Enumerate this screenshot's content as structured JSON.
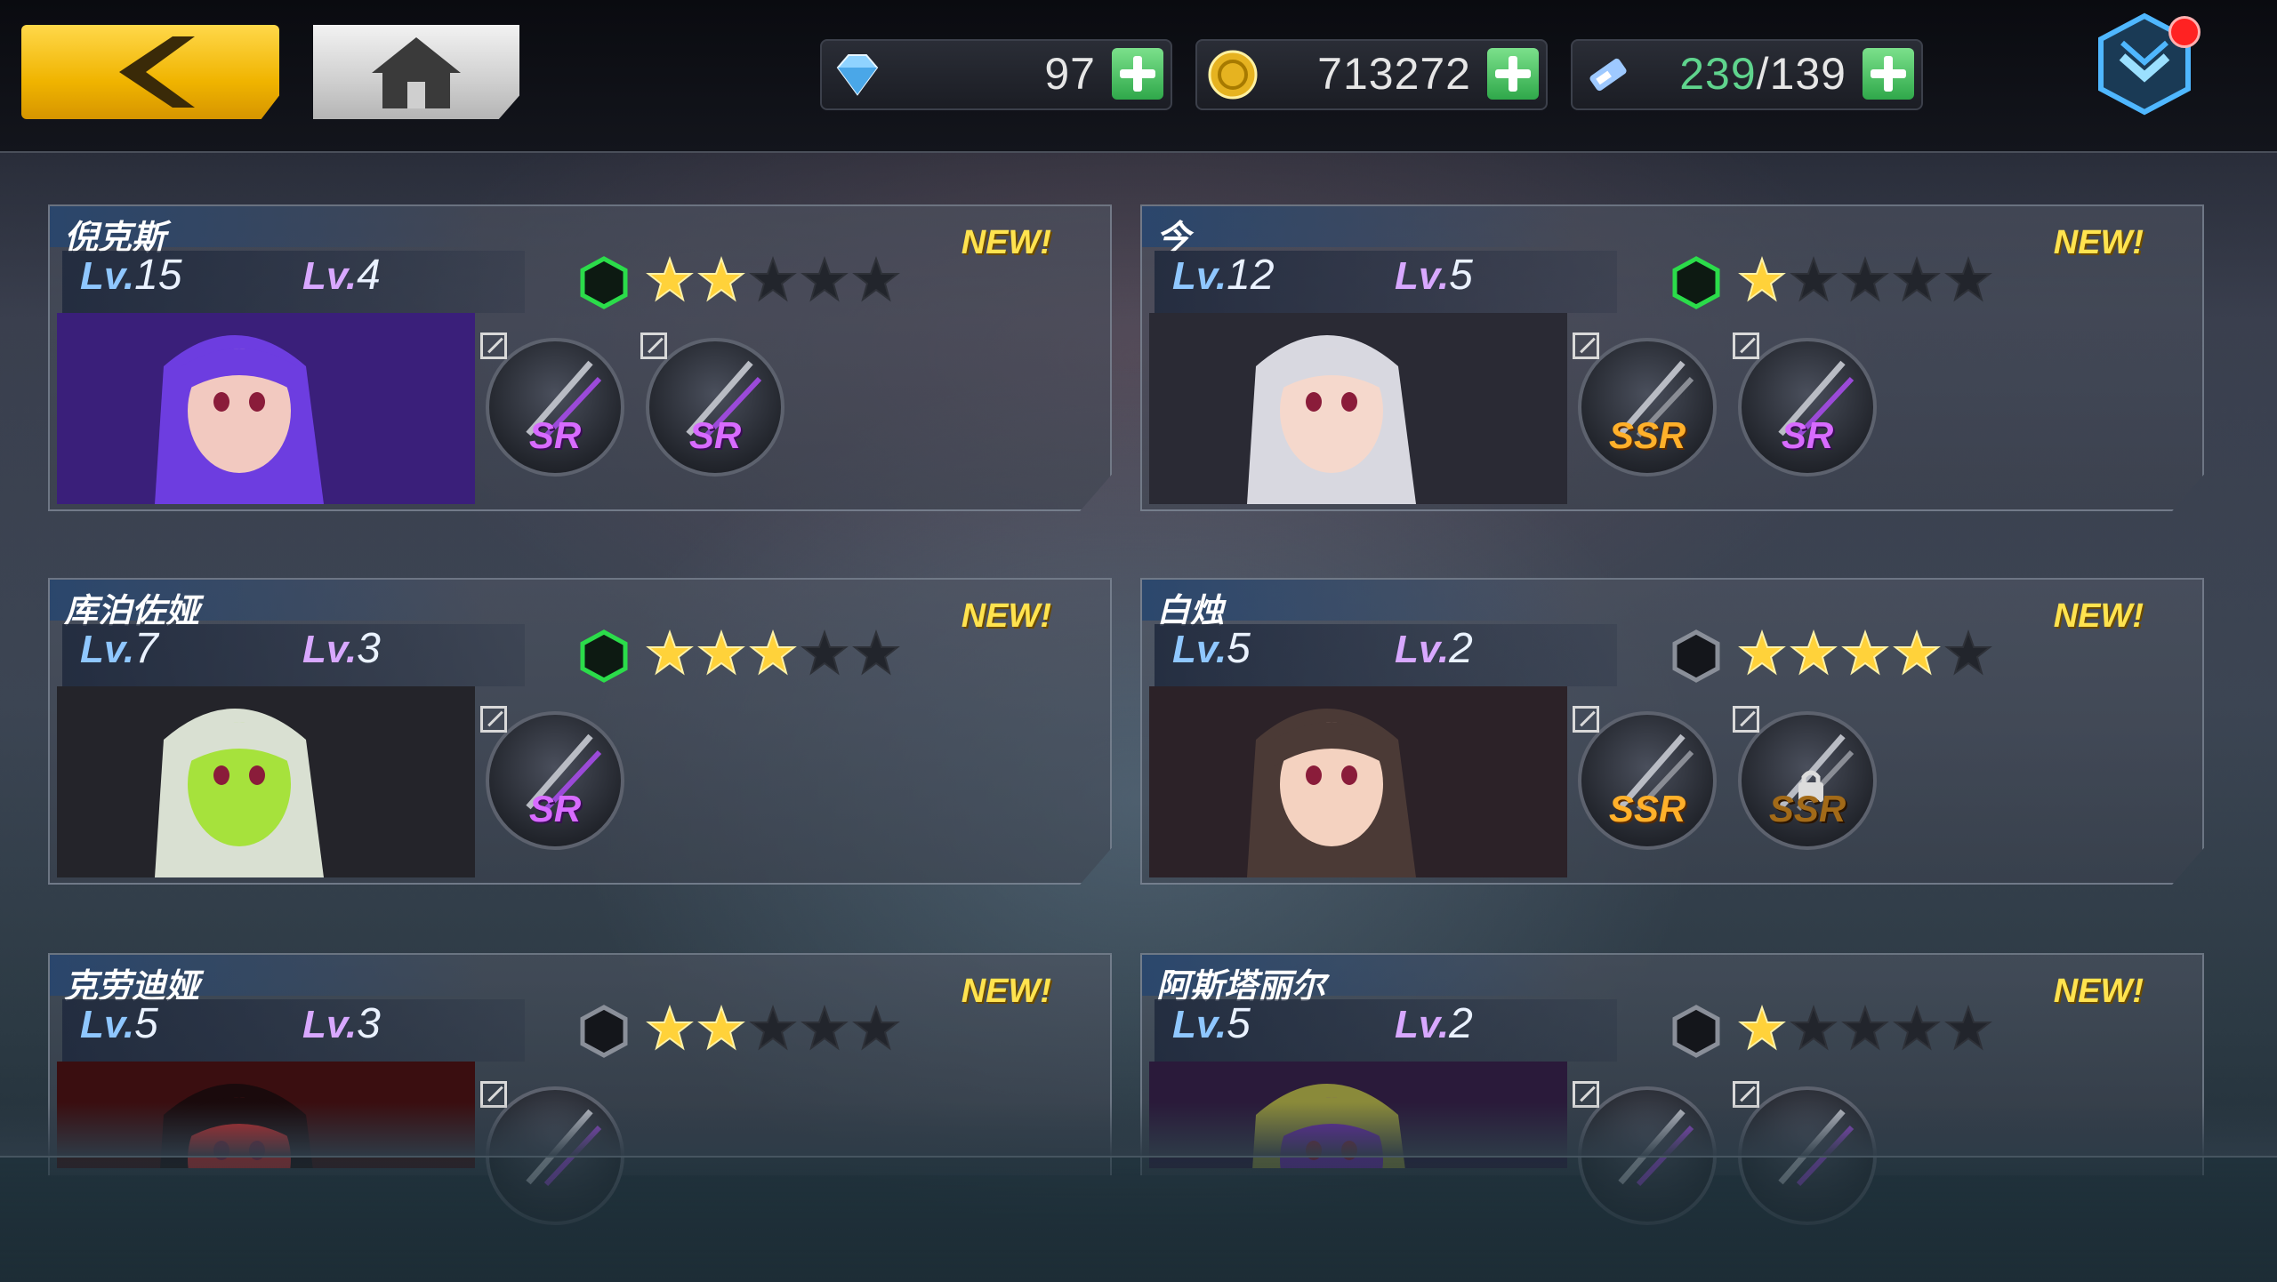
{
  "resources": {
    "diamonds": {
      "value": "97",
      "icon": "diamond-icon"
    },
    "gold": {
      "value": "713272",
      "icon": "coin-icon"
    },
    "stamina": {
      "current": "239",
      "max": "/139",
      "icon": "energy-ticket-icon"
    }
  },
  "colors": {
    "accent_yellow": "#f0b400",
    "plus_green": "#2fa84a",
    "sr": "#d86bff",
    "ssr": "#ffb02a",
    "new": "#ffe34f"
  },
  "cards": [
    {
      "name": "倪克斯",
      "new": "NEW!",
      "lv_prefix": "Lv.",
      "lv": "15",
      "rank_prefix": "Lv.",
      "rank": "4",
      "hex": "green",
      "stars": 2,
      "equips": [
        {
          "rarity": "SR",
          "locked": false
        },
        {
          "rarity": "SR",
          "locked": false
        }
      ],
      "portrait": "purple"
    },
    {
      "name": "今",
      "new": "NEW!",
      "lv_prefix": "Lv.",
      "lv": "12",
      "rank_prefix": "Lv.",
      "rank": "5",
      "hex": "green",
      "stars": 1,
      "equips": [
        {
          "rarity": "SSR",
          "locked": false
        },
        {
          "rarity": "SR",
          "locked": false
        }
      ],
      "portrait": "white"
    },
    {
      "name": "库泊佐娅",
      "new": "NEW!",
      "lv_prefix": "Lv.",
      "lv": "7",
      "rank_prefix": "Lv.",
      "rank": "3",
      "hex": "green",
      "stars": 3,
      "equips": [
        {
          "rarity": "SR",
          "locked": false
        }
      ],
      "portrait": "green"
    },
    {
      "name": "白烛",
      "new": "NEW!",
      "lv_prefix": "Lv.",
      "lv": "5",
      "rank_prefix": "Lv.",
      "rank": "2",
      "hex": "grey",
      "stars": 4,
      "equips": [
        {
          "rarity": "SSR",
          "locked": false
        },
        {
          "rarity": "SSR",
          "locked": true
        }
      ],
      "portrait": "brown"
    },
    {
      "name": "克劳迪娅",
      "new": "NEW!",
      "lv_prefix": "Lv.",
      "lv": "5",
      "rank_prefix": "Lv.",
      "rank": "3",
      "hex": "grey",
      "stars": 2,
      "equips": [
        {
          "rarity": "",
          "locked": false
        }
      ],
      "portrait": "red"
    },
    {
      "name": "阿斯塔丽尔",
      "new": "NEW!",
      "lv_prefix": "Lv.",
      "lv": "5",
      "rank_prefix": "Lv.",
      "rank": "2",
      "hex": "grey",
      "stars": 1,
      "equips": [
        {
          "rarity": "",
          "locked": false
        },
        {
          "rarity": "",
          "locked": false
        }
      ],
      "portrait": "olive"
    }
  ]
}
